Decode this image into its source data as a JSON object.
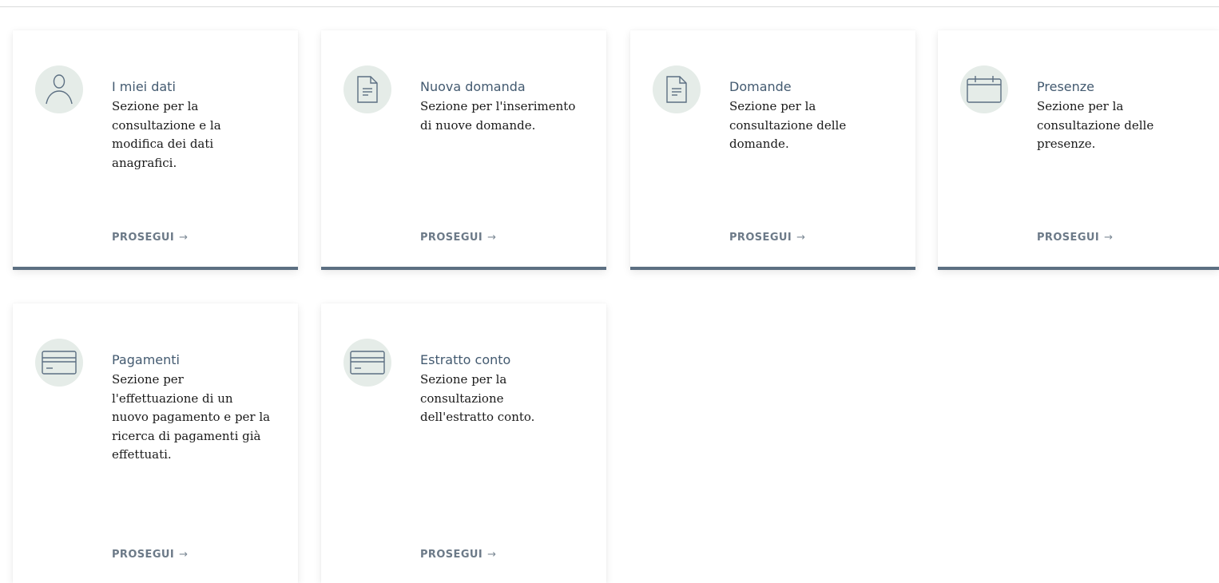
{
  "colors": {
    "title": "#435a70",
    "link": "#6c7a88",
    "card_border": "#5c6f82",
    "icon_bg": "#e5ece8"
  },
  "cards": [
    {
      "title": "I miei dati",
      "description": "Sezione per la consultazione e la modifica dei dati anagrafici.",
      "link_label": "PROSEGUI",
      "arrow": "→",
      "icon": "user-icon"
    },
    {
      "title": "Nuova domanda",
      "description": "Sezione per l'inserimento di nuove domande.",
      "link_label": "PROSEGUI",
      "arrow": "→",
      "icon": "document-icon"
    },
    {
      "title": "Domande",
      "description": "Sezione per la consultazione delle domande.",
      "link_label": "PROSEGUI",
      "arrow": "→",
      "icon": "document-icon"
    },
    {
      "title": "Presenze",
      "description": "Sezione per la consultazione delle presenze.",
      "link_label": "PROSEGUI",
      "arrow": "→",
      "icon": "calendar-icon"
    },
    {
      "title": "Pagamenti",
      "description": "Sezione per l'effettuazione di un nuovo pagamento e per la ricerca di pagamenti già effettuati.",
      "link_label": "PROSEGUI",
      "arrow": "→",
      "icon": "credit-card-icon"
    },
    {
      "title": "Estratto conto",
      "description": "Sezione per la consultazione dell'estratto conto.",
      "link_label": "PROSEGUI",
      "arrow": "→",
      "icon": "credit-card-icon"
    }
  ]
}
